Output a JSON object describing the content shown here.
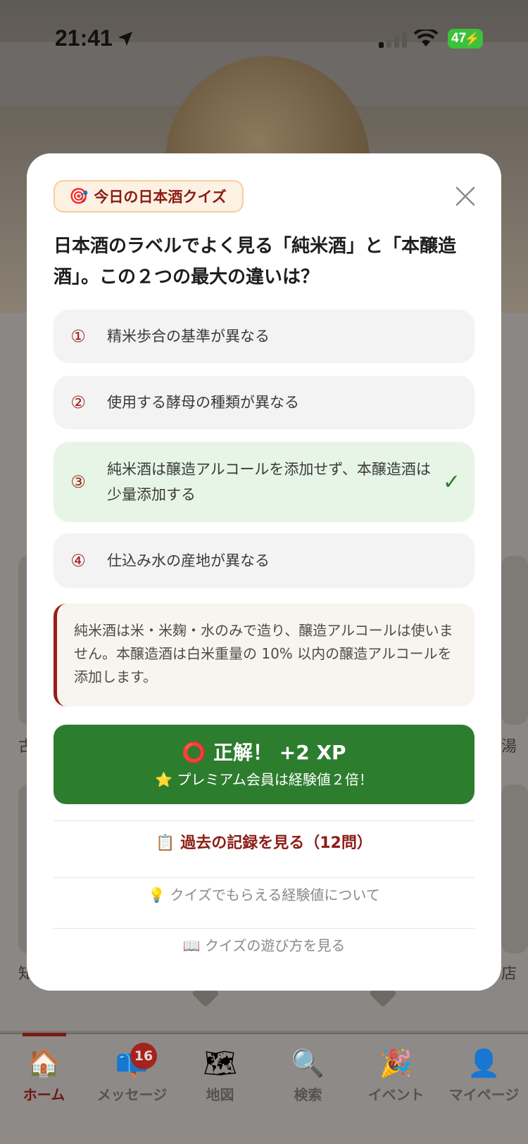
{
  "status_bar": {
    "time": "21:41",
    "battery": "47"
  },
  "background": {
    "label_left_1": "古",
    "label_right_1": "湯",
    "label_left_2": "知",
    "label_right_2": "店"
  },
  "tabs": [
    {
      "label": "ホーム",
      "icon": "house-icon"
    },
    {
      "label": "メッセージ",
      "icon": "mailbox-icon",
      "badge": "16"
    },
    {
      "label": "地図",
      "icon": "map-icon"
    },
    {
      "label": "検索",
      "icon": "magnifier-icon"
    },
    {
      "label": "イベント",
      "icon": "party-popper-icon"
    },
    {
      "label": "マイページ",
      "icon": "person-icon"
    }
  ],
  "quiz": {
    "tag": "今日の日本酒クイズ",
    "question": "日本酒のラベルでよく見る「純米酒」と「本醸造酒」。この２つの最大の違いは？",
    "options": [
      {
        "num": "①",
        "text": "精米歩合の基準が異なる"
      },
      {
        "num": "②",
        "text": "使用する酵母の種類が異なる"
      },
      {
        "num": "③",
        "text": "純米酒は醸造アルコールを添加せず、本醸造酒は少量添加する",
        "correct": true
      },
      {
        "num": "④",
        "text": "仕込み水の産地が異なる"
      }
    ],
    "explanation": "純米酒は米・米麹・水のみで造り、醸造アルコールは使いません。本醸造酒は白米重量の 10% 以内の醸造アルコールを添加します。",
    "result_main": "⭕ 正解！ +2 XP",
    "result_sub": "⭐ プレミアム会員は経験値２倍！",
    "history_link": "📋 過去の記録を見る（12問）",
    "xp_info_link": "💡 クイズでもらえる経験値について",
    "howto_link": "📖 クイズの遊び方を見る"
  }
}
